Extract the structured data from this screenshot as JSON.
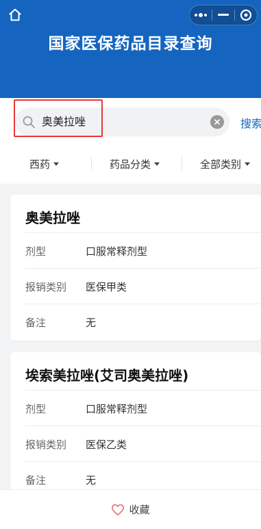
{
  "header": {
    "title": "国家医保药品目录查询",
    "background_color": "#1565c0",
    "icons": [
      "home-icon",
      "more-icon",
      "minimize-icon",
      "close-circle-icon"
    ]
  },
  "search": {
    "query": "奥美拉唑",
    "button_label": "搜索",
    "highlight_color": "#e53935"
  },
  "filters": [
    {
      "label": "西药"
    },
    {
      "label": "药品分类"
    },
    {
      "label": "全部类别"
    }
  ],
  "results": [
    {
      "name": "奥美拉唑",
      "fields": [
        {
          "key": "剂型",
          "value": "口服常释剂型"
        },
        {
          "key": "报销类别",
          "value": "医保甲类"
        },
        {
          "key": "备注",
          "value": "无"
        }
      ]
    },
    {
      "name": "埃索美拉唑(艾司奥美拉唑)",
      "fields": [
        {
          "key": "剂型",
          "value": "口服常释剂型"
        },
        {
          "key": "报销类别",
          "value": "医保乙类"
        },
        {
          "key": "备注",
          "value": "无"
        }
      ]
    }
  ],
  "footer": {
    "favorite_label": "收藏"
  }
}
